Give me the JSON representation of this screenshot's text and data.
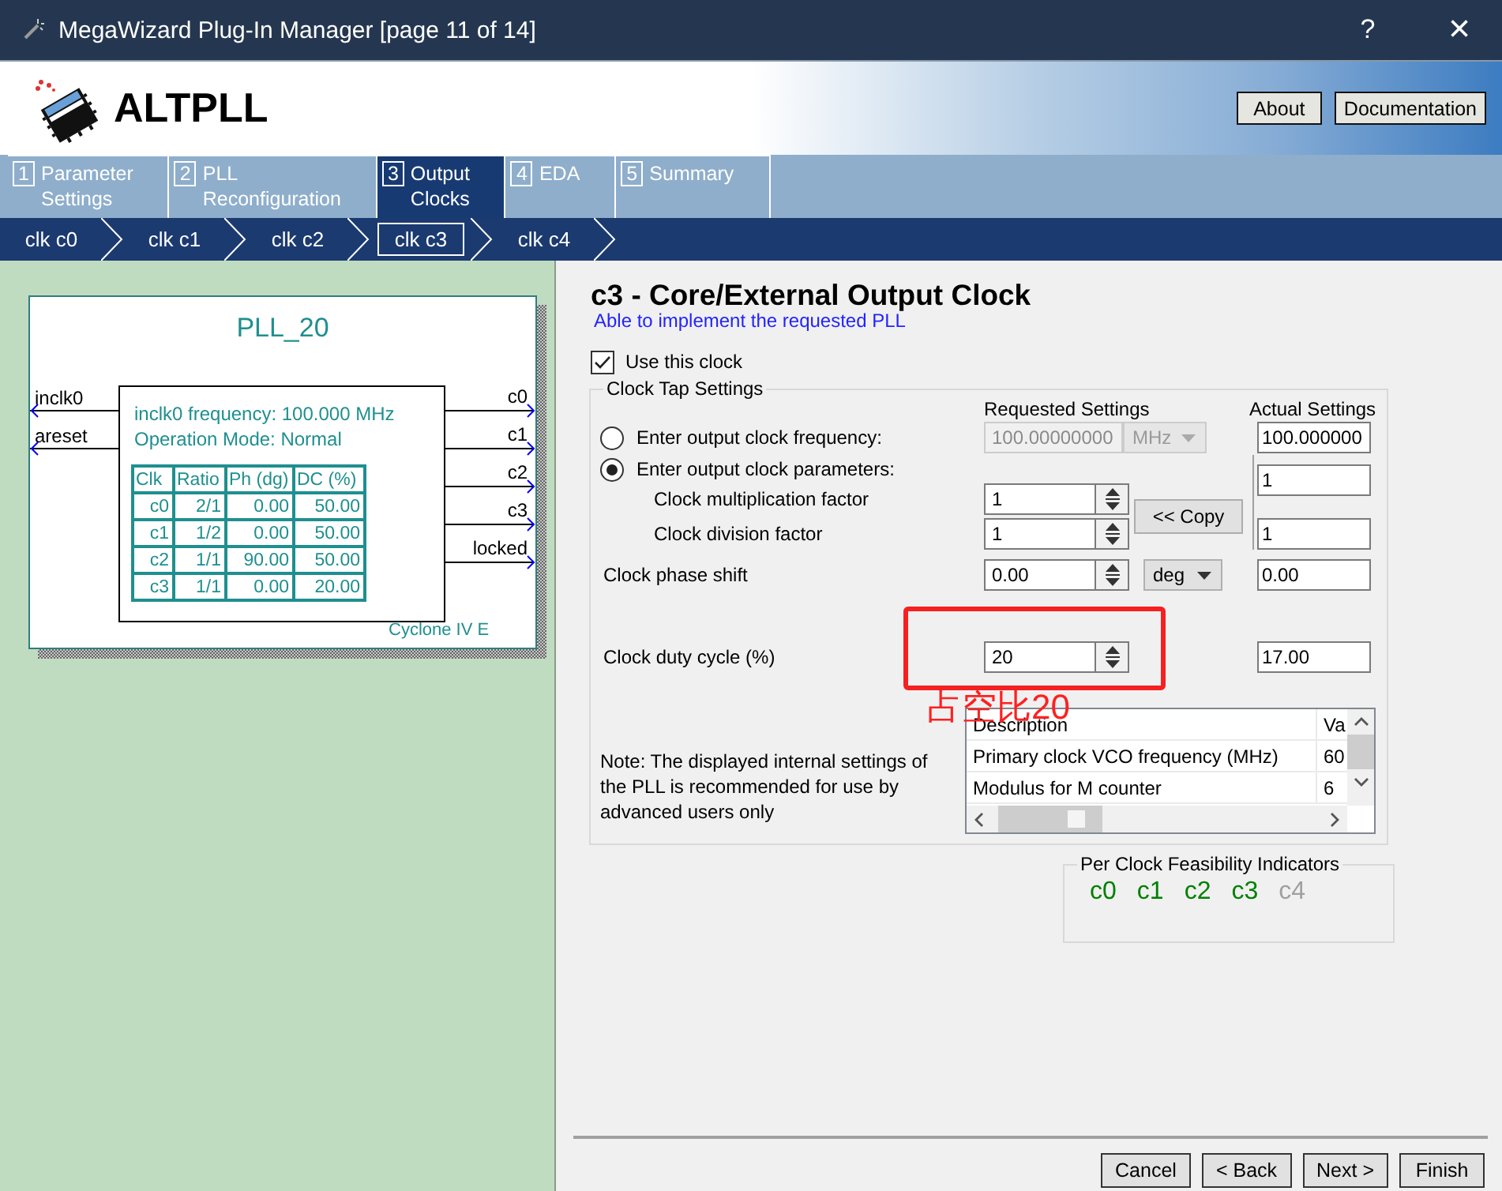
{
  "window": {
    "title": "MegaWizard Plug-In Manager [page 11 of 14]",
    "help": "?",
    "close": "×"
  },
  "header": {
    "title": "ALTPLL",
    "buttons": [
      "About",
      "Documentation"
    ]
  },
  "tabs": [
    {
      "number": "1",
      "label": "Parameter\nSettings",
      "selected": false
    },
    {
      "number": "2",
      "label": "PLL\nReconfiguration",
      "selected": false
    },
    {
      "number": "3",
      "label": "Output\nClocks",
      "selected": true
    },
    {
      "number": "4",
      "label": "EDA",
      "selected": false
    },
    {
      "number": "5",
      "label": "Summary",
      "selected": false
    }
  ],
  "clocks": [
    {
      "label": "clk c0",
      "selected": false
    },
    {
      "label": "clk c1",
      "selected": false
    },
    {
      "label": "clk c2",
      "selected": false
    },
    {
      "label": "clk c3",
      "selected": true
    },
    {
      "label": "clk c4",
      "selected": false
    }
  ],
  "diagram": {
    "title": "PLL_20",
    "inputs": [
      "inclk0",
      "areset"
    ],
    "outputs": [
      "c0",
      "c1",
      "c2",
      "c3",
      "locked"
    ],
    "info": [
      "inclk0 frequency: 100.000 MHz",
      "Operation Mode: Normal"
    ],
    "table": {
      "columns": [
        "Clk",
        "Ratio",
        "Ph (dg)",
        "DC (%)"
      ],
      "rows": [
        [
          "c0",
          "2/1",
          "0.00",
          "50.00"
        ],
        [
          "c1",
          "1/2",
          "0.00",
          "50.00"
        ],
        [
          "c2",
          "1/1",
          "90.00",
          "50.00"
        ],
        [
          "c3",
          "1/1",
          "0.00",
          "20.00"
        ]
      ]
    },
    "device": "Cyclone IV E"
  },
  "output_clock": {
    "title": "c3 - Core/External Output Clock",
    "status": "Able to implement the requested PLL",
    "use_clock": {
      "label": "Use this clock",
      "checked": true
    },
    "settings": {
      "title": "Clock Tap Settings",
      "requested_header": "Requested Settings",
      "actual_header": "Actual Settings",
      "frequency_option": {
        "label": "Enter output clock frequency:",
        "selected": false,
        "value": "100.00000000",
        "unit": "MHz",
        "disabled": true,
        "actual": "100.000000"
      },
      "parameters_option": {
        "label": "Enter output clock parameters:",
        "selected": true
      },
      "multiplication": {
        "label": "Clock multiplication factor",
        "value": "1",
        "actual": "1"
      },
      "division": {
        "label": "Clock division factor",
        "value": "1",
        "actual": "1"
      },
      "copy_button": "<< Copy",
      "phase_shift": {
        "label": "Clock phase shift",
        "value": "0.00",
        "unit": "deg",
        "actual": "0.00"
      },
      "duty_cycle": {
        "label": "Clock duty cycle (%)",
        "value": "20",
        "actual": "17.00"
      },
      "note": "Note: The displayed internal settings of the PLL is recommended for use by advanced users only",
      "internal_table": {
        "columns": [
          "Description",
          "Va"
        ],
        "rows": [
          [
            "Primary clock VCO frequency (MHz)",
            "60"
          ],
          [
            "Modulus for M counter",
            "6"
          ]
        ]
      }
    }
  },
  "feasibility": {
    "title": "Per Clock Feasibility Indicators",
    "items": [
      {
        "label": "c0",
        "enabled": true
      },
      {
        "label": "c1",
        "enabled": true
      },
      {
        "label": "c2",
        "enabled": true
      },
      {
        "label": "c3",
        "enabled": true
      },
      {
        "label": "c4",
        "enabled": false
      }
    ]
  },
  "annotation": {
    "text": "占空比20"
  },
  "footer": {
    "buttons": [
      "Cancel",
      "< Back",
      "Next >",
      "Finish"
    ]
  }
}
